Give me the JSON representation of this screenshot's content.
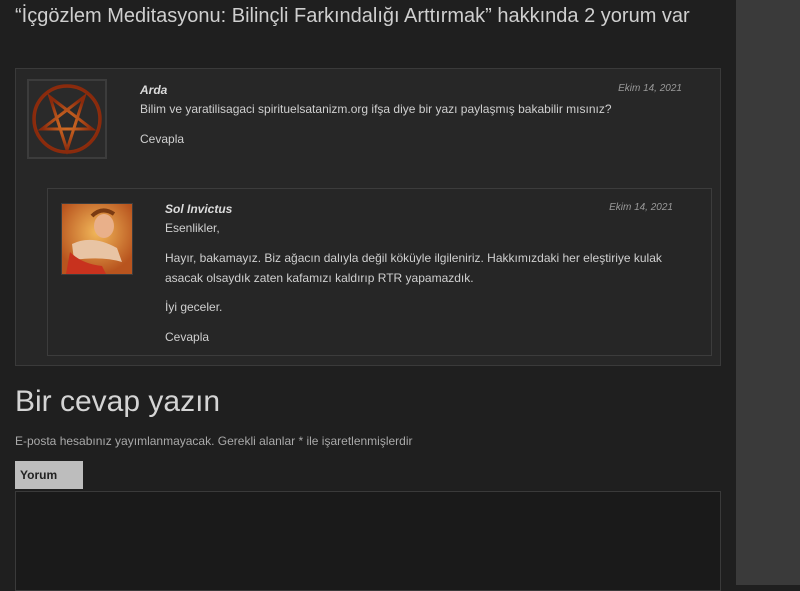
{
  "comments_title": "“İçgözlem Meditasyonu: Bilinçli Farkındalığı Arttırmak” hakkında 2 yorum var",
  "comments": [
    {
      "author": "Arda",
      "date": "Ekim 14, 2021",
      "text": "Bilim ve yaratilisagaci spirituelsatanizm.org ifşa diye bir yazı paylaşmış bakabilir mısınız?",
      "reply_label": "Cevapla",
      "avatar_icon": "pentagram-icon"
    },
    {
      "author": "Sol Invictus",
      "date": "Ekim 14, 2021",
      "greeting": "Esenlikler,",
      "text": "Hayır, bakamayız. Biz ağacın dalıyla değil köküyle ilgileniriz. Hakkımızdaki her eleştiriye kulak asacak olsaydık zaten kafamızı kaldırıp RTR yapamazdık.",
      "closing": "İyi geceler.",
      "reply_label": "Cevapla",
      "avatar_icon": "painting-avatar-icon"
    }
  ],
  "reply_form": {
    "title": "Bir cevap yazın",
    "note": "E-posta hesabınız yayımlanmayacak. Gerekli alanlar * ile işaretlenmişlerdir",
    "comment_label": "Yorum",
    "comment_value": ""
  },
  "colors": {
    "background": "#1f1f1f",
    "box": "#272727",
    "sidebar": "#3a3a3a",
    "pentagram": "#c0501a"
  }
}
